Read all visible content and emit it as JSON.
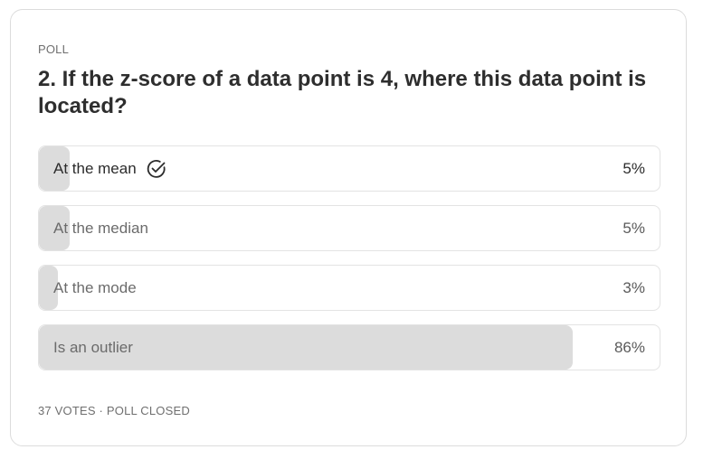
{
  "poll": {
    "eyebrow": "POLL",
    "question": "2. If the z-score of a data point is 4, where this data point is located?",
    "options": [
      {
        "label": "At the mean",
        "percent_label": "5%",
        "percent": 5,
        "selected": true
      },
      {
        "label": "At the median",
        "percent_label": "5%",
        "percent": 5,
        "selected": false
      },
      {
        "label": "At the mode",
        "percent_label": "3%",
        "percent": 3,
        "selected": false
      },
      {
        "label": "Is an outlier",
        "percent_label": "86%",
        "percent": 86,
        "selected": false
      }
    ],
    "footer": "37 VOTES · POLL CLOSED"
  },
  "icons": {
    "selected_option": "check-circle-icon"
  },
  "colors": {
    "bar_fill": "#dcdcdc",
    "border": "#e3e3e3",
    "text": "#2b2b2b",
    "muted_text": "#6f6f6f"
  }
}
